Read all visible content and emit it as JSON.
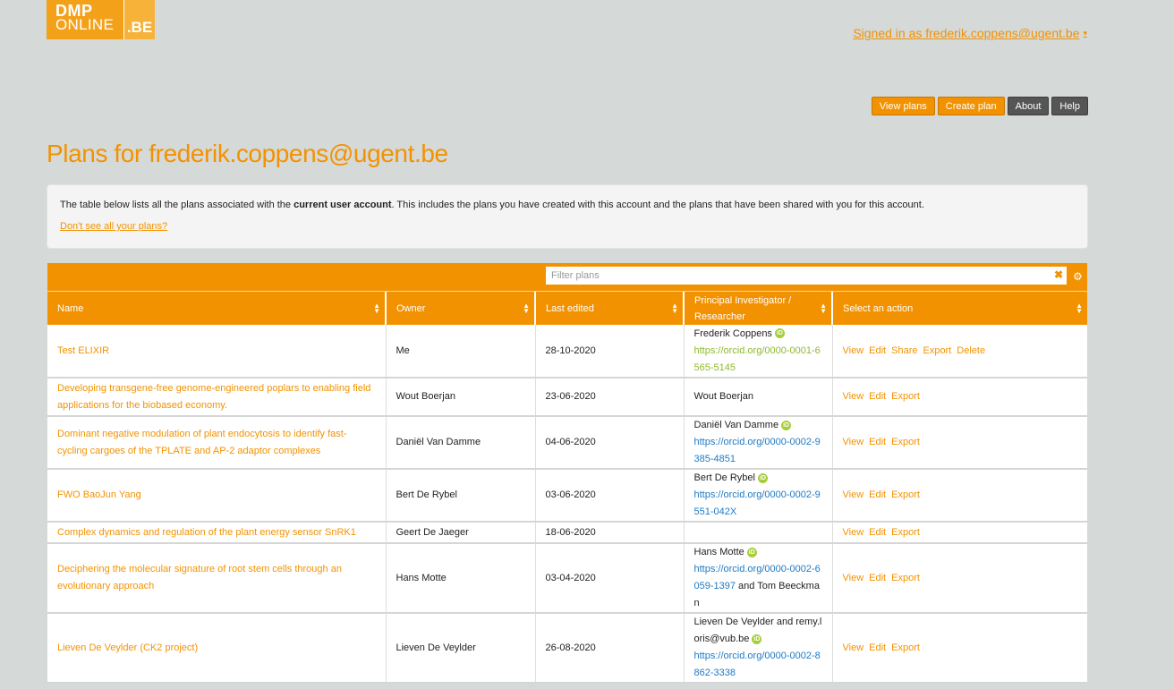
{
  "logo": {
    "line1": "DMP",
    "line2": "ONLINE",
    "suffix": ".BE"
  },
  "user": {
    "signed_in_label": "Signed in as frederik.coppens@ugent.be"
  },
  "nav": {
    "view_plans": "View plans",
    "create_plan": "Create plan",
    "about": "About",
    "help": "Help"
  },
  "page": {
    "title": "Plans for frederik.coppens@ugent.be"
  },
  "info": {
    "text_before": "The table below lists all the plans associated with the ",
    "text_bold": "current user account",
    "text_after": ". This includes the plans you have created with this account and the plans that have been shared with you for this account.",
    "link": "Don't see all your plans?"
  },
  "filter": {
    "placeholder": "Filter plans",
    "clear_icon": "✖",
    "settings_icon": "gear-icon"
  },
  "table": {
    "headers": [
      "Name",
      "Owner",
      "Last edited",
      "Principal Investigator / Researcher",
      "Select an action"
    ],
    "rows": [
      {
        "name": "Test ELIXIR",
        "owner": "Me",
        "date": "28-10-2020",
        "pi_name": "Frederik Coppens",
        "pi_orcid": "https://orcid.org/0000-0001-6565-5145",
        "pi_suffix": "",
        "actions": [
          "View",
          "Edit",
          "Share",
          "Export",
          "Delete"
        ]
      },
      {
        "name": "Developing transgene-free genome-engineered poplars to enabling field applications for the biobased economy.",
        "owner": "Wout Boerjan",
        "date": "23-06-2020",
        "pi_name": "Wout Boerjan",
        "pi_orcid": "",
        "pi_suffix": "",
        "actions": [
          "View",
          "Edit",
          "Export"
        ]
      },
      {
        "name": "Dominant negative modulation of plant endocytosis to identify fast-cycling cargoes of the TPLATE and AP-2 adaptor complexes",
        "owner": "Daniël Van Damme",
        "date": "04-06-2020",
        "pi_name": "Daniël Van Damme",
        "pi_orcid": "https://orcid.org/0000-0002-9385-4851",
        "pi_suffix": "",
        "actions": [
          "View",
          "Edit",
          "Export"
        ]
      },
      {
        "name": "FWO BaoJun Yang",
        "owner": "Bert De Rybel",
        "date": "03-06-2020",
        "pi_name": "Bert De Rybel",
        "pi_orcid": "https://orcid.org/0000-0002-9551-042X",
        "pi_suffix": "",
        "actions": [
          "View",
          "Edit",
          "Export"
        ]
      },
      {
        "name": "Complex dynamics and regulation of the plant energy sensor SnRK1",
        "owner": "Geert De Jaeger",
        "date": "18-06-2020",
        "pi_name": "",
        "pi_orcid": "",
        "pi_suffix": "",
        "actions": [
          "View",
          "Edit",
          "Export"
        ]
      },
      {
        "name": "Deciphering the molecular signature of root stem cells through an evolutionary approach",
        "owner": "Hans Motte",
        "date": "03-04-2020",
        "pi_name": "Hans Motte",
        "pi_orcid": "https://orcid.org/0000-0002-6059-1397",
        "pi_suffix": " and Tom Beeckman",
        "actions": [
          "View",
          "Edit",
          "Export"
        ]
      },
      {
        "name": "Lieven De Veylder (CK2 project)",
        "owner": "Lieven De Veylder",
        "date": "26-08-2020",
        "pi_name": "Lieven De Veylder and remy.loris@vub.be",
        "pi_orcid": "https://orcid.org/0000-0002-8862-3338",
        "pi_suffix": "",
        "actions": [
          "View",
          "Edit",
          "Export"
        ]
      }
    ]
  },
  "colors": {
    "accent": "#f39200",
    "background": "#d5d9d8",
    "orcid": "#a6ce39",
    "link_blue": "#1f7ac4"
  }
}
